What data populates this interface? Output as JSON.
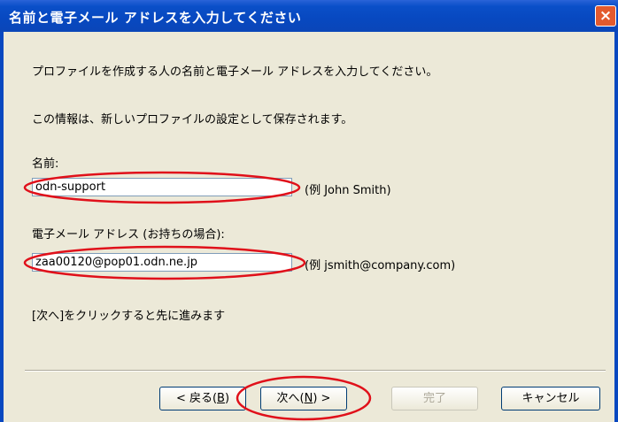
{
  "window": {
    "title": "名前と電子メール アドレスを入力してください",
    "close_icon": "×"
  },
  "body": {
    "line1": "プロファイルを作成する人の名前と電子メール アドレスを入力してください。",
    "line2": "この情報は、新しいプロファイルの設定として保存されます。",
    "next_hint": "[次へ]をクリックすると先に進みます"
  },
  "name": {
    "label": "名前:",
    "value": "odn-support",
    "example": "(例 John Smith)"
  },
  "email": {
    "label": "電子メール アドレス (お持ちの場合):",
    "value": "zaa00120@pop01.odn.ne.jp",
    "example": "(例 jsmith@company.com)"
  },
  "buttons": {
    "back": {
      "pre": "< 戻る(",
      "key": "B",
      "post": ")"
    },
    "next": {
      "pre": "次へ(",
      "key": "N",
      "post": ") >"
    },
    "finish": "完了",
    "cancel": "キャンセル"
  },
  "annotation_color": "#e0101a"
}
